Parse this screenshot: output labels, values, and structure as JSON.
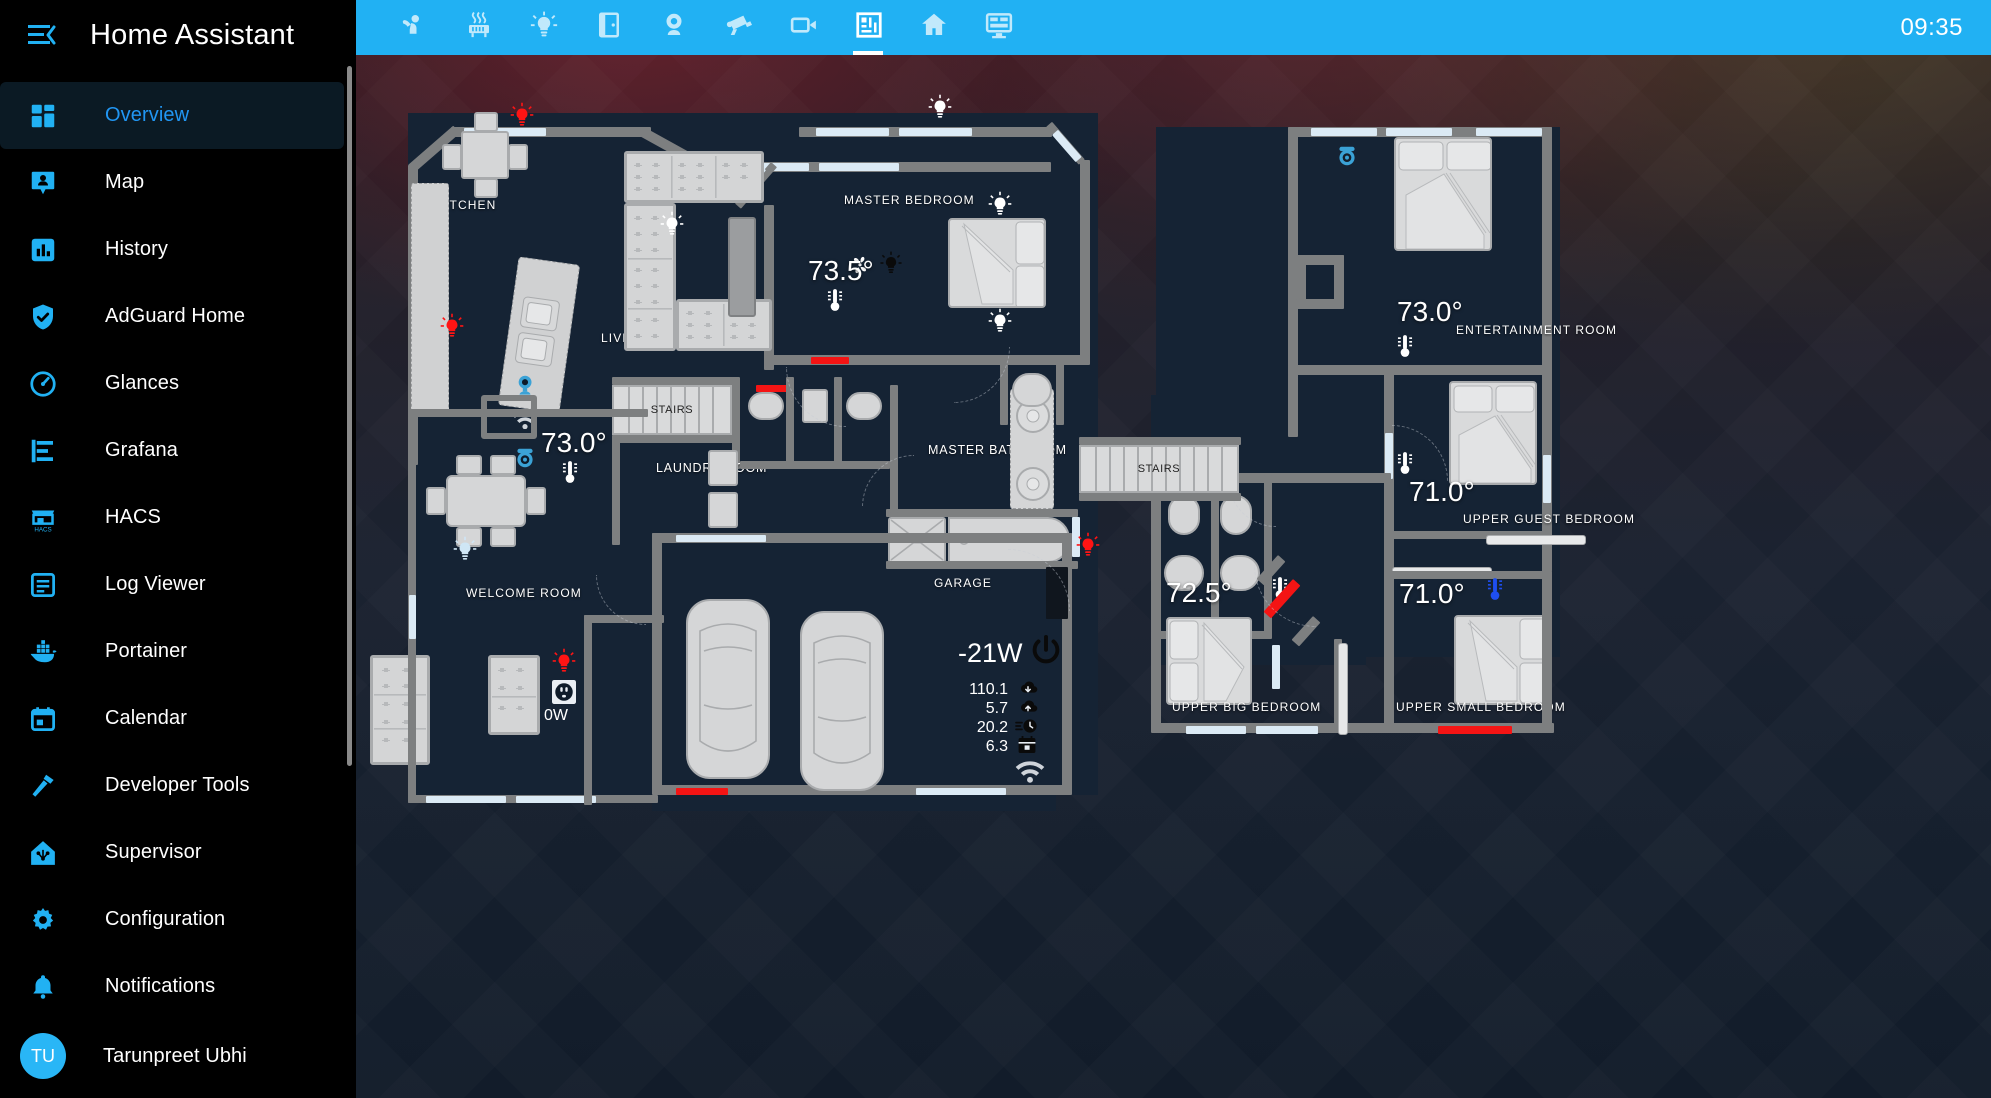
{
  "app": {
    "title": "Home Assistant",
    "clock": "09:35",
    "accent": "#21b1f3",
    "sidebar_bg": "#000000"
  },
  "sidebar": {
    "menu_icon": "hamburger-collapse-icon",
    "items": [
      {
        "label": "Overview",
        "icon": "view-dashboard-icon",
        "active": true
      },
      {
        "label": "Map",
        "icon": "map-marker-account-icon",
        "active": false
      },
      {
        "label": "History",
        "icon": "chart-box-icon",
        "active": false
      },
      {
        "label": "AdGuard Home",
        "icon": "shield-check-icon",
        "active": false
      },
      {
        "label": "Glances",
        "icon": "gauge-icon",
        "active": false
      },
      {
        "label": "Grafana",
        "icon": "chart-bar-stacked-icon",
        "active": false
      },
      {
        "label": "HACS",
        "icon": "hacs-store-icon",
        "active": false
      },
      {
        "label": "Log Viewer",
        "icon": "text-box-icon",
        "active": false
      },
      {
        "label": "Portainer",
        "icon": "docker-whale-icon",
        "active": false
      },
      {
        "label": "Calendar",
        "icon": "calendar-icon",
        "active": false
      },
      {
        "label": "Developer Tools",
        "icon": "hammer-icon",
        "active": false
      },
      {
        "label": "Supervisor",
        "icon": "home-assistant-supervisor-icon",
        "active": false
      },
      {
        "label": "Configuration",
        "icon": "cog-icon",
        "active": false
      },
      {
        "label": "Notifications",
        "icon": "bell-icon",
        "active": false
      }
    ],
    "user": {
      "initials": "TU",
      "name": "Tarunpreet Ubhi"
    }
  },
  "tabs": [
    {
      "icon": "person-couch-icon",
      "active": false
    },
    {
      "icon": "radiator-icon",
      "active": false
    },
    {
      "icon": "lightbulb-icon",
      "active": false
    },
    {
      "icon": "door-icon",
      "active": false
    },
    {
      "icon": "webcam-icon",
      "active": false
    },
    {
      "icon": "cctv-icon",
      "active": false
    },
    {
      "icon": "video-camera-icon",
      "active": false
    },
    {
      "icon": "floorplan-icon",
      "active": true
    },
    {
      "icon": "home-icon",
      "active": false
    },
    {
      "icon": "monitor-dashboard-icon",
      "active": false
    }
  ],
  "floorplan": {
    "rooms": [
      {
        "name": "KITCHEN"
      },
      {
        "name": "LIVING ROOM"
      },
      {
        "name": "MASTER BEDROOM"
      },
      {
        "name": "MASTER BATHROOM"
      },
      {
        "name": "LAUNDRY ROOM"
      },
      {
        "name": "WELCOME ROOM"
      },
      {
        "name": "GARAGE"
      },
      {
        "name": "STAIRS"
      },
      {
        "name": "STAIRS"
      },
      {
        "name": "ENTERTAINMENT ROOM"
      },
      {
        "name": "UPPER GUEST BEDROOM"
      },
      {
        "name": "UPPER BIG BEDROOM"
      },
      {
        "name": "UPPER SMALL BEDROOM"
      }
    ],
    "temperatures": [
      {
        "room": "MASTER BEDROOM",
        "value": "73.5°",
        "icon": "thermometer-icon",
        "color": "#ffffff"
      },
      {
        "room": "WELCOME ROOM",
        "value": "73.0°",
        "icon": "thermometer-icon",
        "color": "#ffffff"
      },
      {
        "room": "ENTERTAINMENT ROOM",
        "value": "73.0°",
        "icon": "thermometer-icon",
        "color": "#ffffff"
      },
      {
        "room": "UPPER GUEST BEDROOM",
        "value": "71.0°",
        "icon": "thermometer-icon",
        "color": "#ffffff"
      },
      {
        "room": "UPPER BIG BEDROOM",
        "value": "72.5°",
        "icon": "thermometer-icon",
        "color": "#ffffff"
      },
      {
        "room": "UPPER SMALL BEDROOM",
        "value": "71.0°",
        "icon": "thermometer-icon",
        "color": "#1e4ef0"
      }
    ],
    "power": {
      "main_value": "-21W",
      "main_icon": "power-icon",
      "rows": [
        {
          "value": "110.1",
          "icon": "cloud-download-icon"
        },
        {
          "value": "5.7",
          "icon": "cloud-upload-icon"
        },
        {
          "value": "20.2",
          "icon": "clock-fast-icon"
        },
        {
          "value": "6.3",
          "icon": "calendar-today-icon"
        }
      ],
      "wifi_icon": "wifi-icon"
    },
    "welcome_room_outlet": {
      "value": "0W",
      "icon": "power-socket-icon"
    },
    "lights": [
      {
        "state": "on-red",
        "location": "kitchen-top"
      },
      {
        "state": "on-red",
        "location": "kitchen-left"
      },
      {
        "state": "on-white",
        "location": "hall-top"
      },
      {
        "state": "on-white",
        "location": "living-room"
      },
      {
        "state": "on-white",
        "location": "master-bedroom-top-right"
      },
      {
        "state": "off",
        "location": "master-bedroom-center"
      },
      {
        "state": "on-white",
        "location": "master-bedroom-bottom-right"
      },
      {
        "state": "on-white",
        "location": "welcome-room"
      },
      {
        "state": "on-red",
        "location": "garage-right"
      },
      {
        "state": "on-red",
        "location": "welcome-room-bottom"
      }
    ],
    "sensors": [
      {
        "icon": "fan-icon",
        "location": "master-bedroom"
      },
      {
        "icon": "camera-icon",
        "location": "hall-upper"
      },
      {
        "icon": "wifi-icon",
        "location": "hall-lower"
      },
      {
        "icon": "camera-icon",
        "location": "welcome-room-upper"
      },
      {
        "icon": "camera-icon",
        "location": "entertainment-room"
      }
    ]
  }
}
